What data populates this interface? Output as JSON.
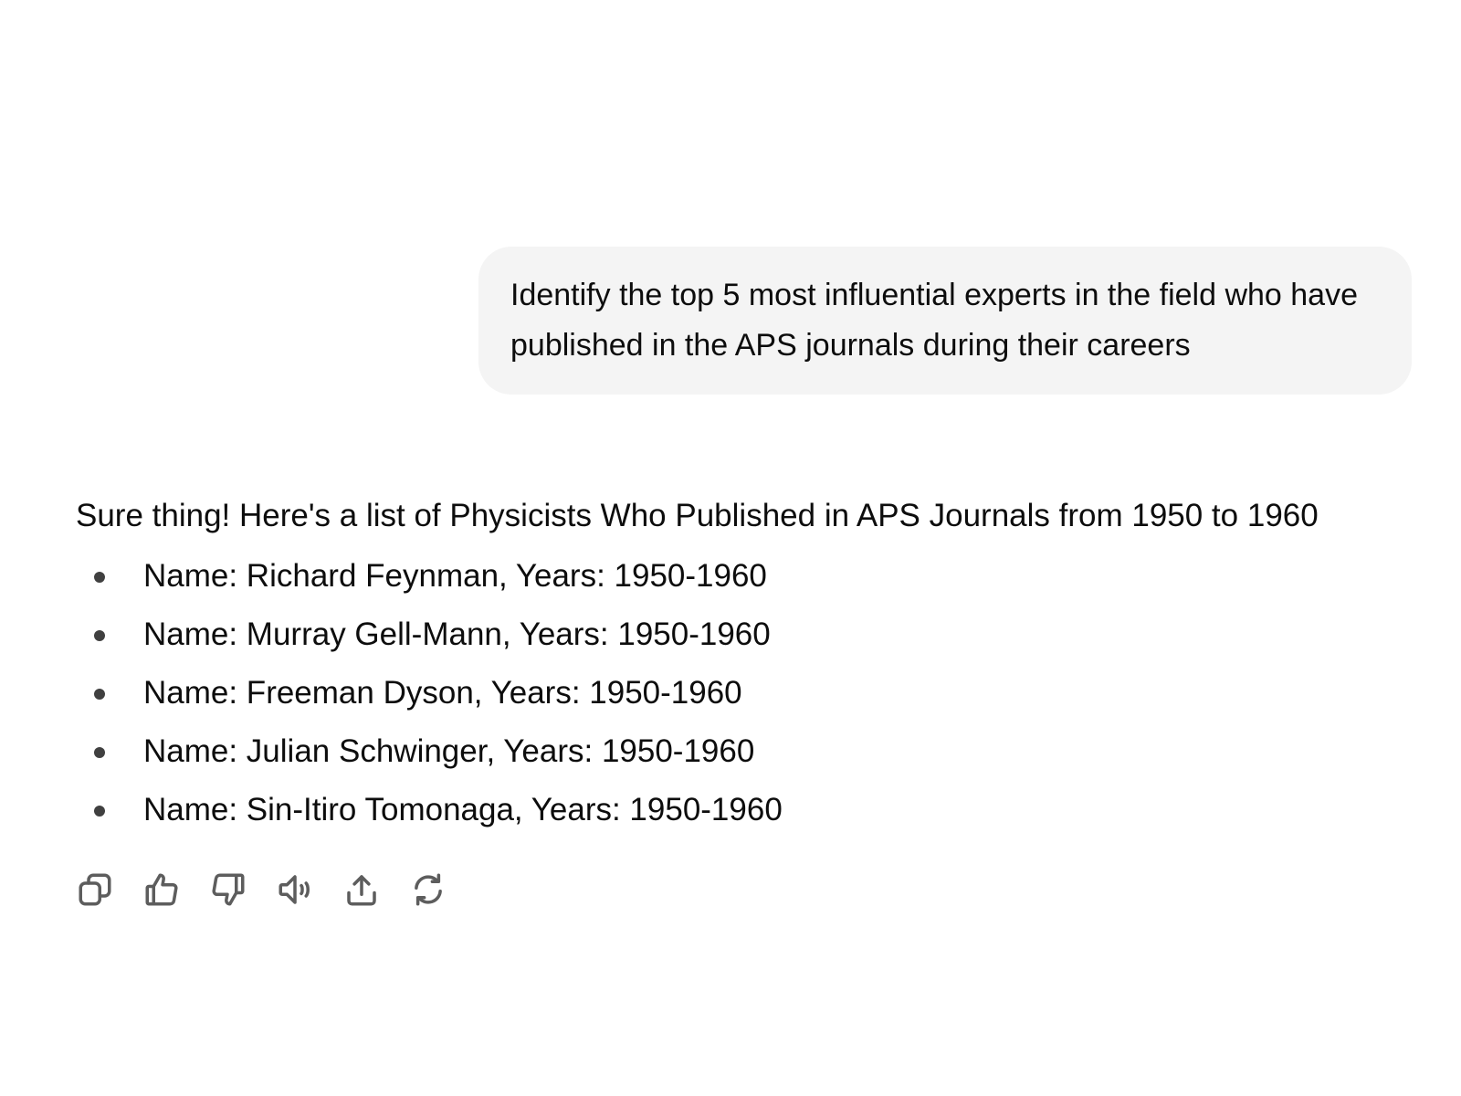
{
  "conversation": {
    "user_message": "Identify the top 5 most influential experts in the field who have published in the APS journals during their careers",
    "assistant_intro": "Sure thing! Here's a list of Physicists Who Published in APS Journals from 1950 to 1960",
    "assistant_items": [
      "Name: Richard Feynman, Years: 1950-1960",
      "Name: Murray Gell-Mann, Years: 1950-1960",
      "Name: Freeman Dyson, Years: 1950-1960",
      "Name: Julian Schwinger, Years: 1950-1960",
      "Name: Sin-Itiro Tomonaga, Years: 1950-1960"
    ]
  },
  "actions": [
    {
      "icon": "copy-icon"
    },
    {
      "icon": "thumbs-up-icon"
    },
    {
      "icon": "thumbs-down-icon"
    },
    {
      "icon": "read-aloud-icon"
    },
    {
      "icon": "share-icon"
    },
    {
      "icon": "regenerate-icon"
    }
  ],
  "colors": {
    "user_bubble_bg": "#f4f4f4",
    "text": "#0d0d0d",
    "icon": "#5d5d5d"
  }
}
